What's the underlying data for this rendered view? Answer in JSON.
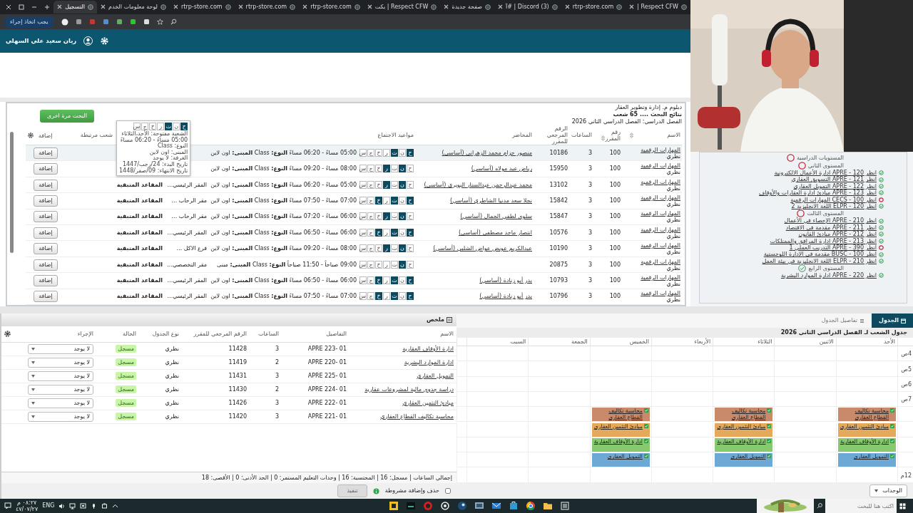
{
  "browser": {
    "tabs": [
      {
        "title": "Respect CFW |",
        "selected": false
      },
      {
        "title": "rtrp-store.com",
        "selected": false
      },
      {
        "title": "(3) Discord | #آ",
        "selected": false
      },
      {
        "title": "صفحة جديدة",
        "selected": false
      },
      {
        "title": "Respect CFW | بكت",
        "selected": false
      },
      {
        "title": "rtrp-store.com",
        "selected": false
      },
      {
        "title": "rtrp-store.com",
        "selected": false
      },
      {
        "title": "rtrp-store.com",
        "selected": false
      },
      {
        "title": "لوحة معلومات الخدم",
        "selected": false
      },
      {
        "title": "التسجيل",
        "selected": true
      }
    ],
    "action_button": "يجب اتخاذ إجراء"
  },
  "header": {
    "user_name": "ريان سعيد علي السهلي"
  },
  "search_results": {
    "program": "دبلوم م. إدارة وتطوير العقار",
    "results": "نتائج البحث .... 65 شعب",
    "term": "الفصل الدراسي: الفصل الدراسي الثاني 2026",
    "search_again": "البحث مرة اخرى",
    "columns": [
      "الاسم",
      "رقم المقرر",
      "الساعات",
      "الرقم المرجعي للمقرر",
      "المحاضر",
      "مواعيد الاجتماع",
      "شعب مرتبطة",
      "إضافة"
    ],
    "rows": [
      {
        "name": "المهارات الرقمية",
        "type": "نظري",
        "course": "100",
        "hours": "3",
        "crn": "10186",
        "instructor": "منصور حزام محمد الزهراني (أساسي)",
        "hovered": true,
        "days": [
          {
            "label": "ح",
            "on": true
          },
          {
            "label": "ن",
            "on": false
          },
          {
            "label": "ث",
            "on": true
          },
          {
            "label": "ر",
            "on": false
          },
          {
            "label": "خ",
            "on": false
          },
          {
            "label": "ج",
            "on": false
          },
          {
            "label": "س",
            "on": false
          }
        ],
        "meeting": "05:00 مساءً - 06:20 مساءً **النوع:** Class **المبنى:** اون لاين",
        "add": "إضافة"
      },
      {
        "name": "المهارات الرقمية",
        "type": "نظري",
        "course": "100",
        "hours": "3",
        "crn": "15950",
        "instructor": "رياض عبد مولاه (أساسي)",
        "hovered": false,
        "days": [
          {
            "label": "ح",
            "on": false
          },
          {
            "label": "ن",
            "on": true
          },
          {
            "label": "ث",
            "on": false
          },
          {
            "label": "ر",
            "on": true
          },
          {
            "label": "خ",
            "on": false
          },
          {
            "label": "ج",
            "on": false
          },
          {
            "label": "س",
            "on": false
          }
        ],
        "meeting": "08:00 مساءً - 09:20 مساءً **النوع:** Class **المبنى:** اون لاين",
        "add": "إضافة"
      },
      {
        "name": "المهارات الرقمية",
        "type": "نظري",
        "course": "100",
        "hours": "3",
        "crn": "13102",
        "instructor": "محمد عبدالرحمن عبدالستار البويري (أساسي)",
        "hovered": false,
        "days": [
          {
            "label": "ح",
            "on": false
          },
          {
            "label": "ن",
            "on": true
          },
          {
            "label": "ث",
            "on": false
          },
          {
            "label": "ر",
            "on": true
          },
          {
            "label": "خ",
            "on": false
          },
          {
            "label": "ج",
            "on": false
          },
          {
            "label": "س",
            "on": false
          }
        ],
        "meeting": "05:00 مساءً - 06:20 مساءً **النوع:** Class **المبنى:** اون لاين",
        "building": "المقر الرئيسي...",
        "hall": "المقاعد المتبقية",
        "add": "إضافة"
      },
      {
        "name": "المهارات الرقمية",
        "type": "نظري",
        "course": "100",
        "hours": "3",
        "crn": "15842",
        "instructor": "نجلا سعد مدنيا الشاطري (أساسي)",
        "hovered": false,
        "days": [
          {
            "label": "ح",
            "on": true
          },
          {
            "label": "ن",
            "on": false
          },
          {
            "label": "ث",
            "on": true
          },
          {
            "label": "ر",
            "on": false
          },
          {
            "label": "خ",
            "on": true
          },
          {
            "label": "ج",
            "on": false
          },
          {
            "label": "س",
            "on": false
          }
        ],
        "meeting": "07:00 مساءً - 07:50 مساءً **النوع:** Class **المبنى:** اون لاين",
        "building": "مقر الرحاب ...",
        "hall": "المقاعد المتبقية",
        "add": "إضافة"
      },
      {
        "name": "المهارات الرقمية",
        "type": "نظري",
        "course": "100",
        "hours": "3",
        "crn": "15847",
        "instructor": "سلوى لطفي الجمال (أساسي)",
        "hovered": false,
        "days": [
          {
            "label": "ح",
            "on": false
          },
          {
            "label": "ن",
            "on": true
          },
          {
            "label": "ث",
            "on": false
          },
          {
            "label": "ر",
            "on": true
          },
          {
            "label": "خ",
            "on": false
          },
          {
            "label": "ج",
            "on": false
          },
          {
            "label": "س",
            "on": false
          }
        ],
        "meeting": "06:00 مساءً - 07:20 مساءً **النوع:** Class **المبنى:** اون لاين",
        "building": "مقر الرحاب ...",
        "hall": "المقاعد المتبقية",
        "add": "إضافة"
      },
      {
        "name": "المهارات الرقمية",
        "type": "نظري",
        "course": "100",
        "hours": "3",
        "crn": "10576",
        "instructor": "انتصار ماجد مصطفى (أساسي)",
        "hovered": false,
        "days": [
          {
            "label": "ح",
            "on": true
          },
          {
            "label": "ن",
            "on": false
          },
          {
            "label": "ث",
            "on": true
          },
          {
            "label": "ر",
            "on": false
          },
          {
            "label": "خ",
            "on": true
          },
          {
            "label": "ج",
            "on": false
          },
          {
            "label": "س",
            "on": false
          }
        ],
        "meeting": "06:00 مساءً - 06:50 مساءً **النوع:** Class **المبنى:** اون لاين",
        "building": "المقر الرئيسي...",
        "hall": "المقاعد المتبقية",
        "add": "إضافة"
      },
      {
        "name": "المهارات الرقمية",
        "type": "نظري",
        "course": "100",
        "hours": "3",
        "crn": "10190",
        "instructor": "عبدالكريم عويض عواض الشلبي (أساسي)",
        "hovered": false,
        "days": [
          {
            "label": "ح",
            "on": false
          },
          {
            "label": "ن",
            "on": true
          },
          {
            "label": "ث",
            "on": false
          },
          {
            "label": "ر",
            "on": true
          },
          {
            "label": "خ",
            "on": false
          },
          {
            "label": "ج",
            "on": false
          },
          {
            "label": "س",
            "on": false
          }
        ],
        "meeting": "08:00 مساءً - 09:20 مساءً **النوع:** Class **المبنى:** اون لاين",
        "building": "فرع الاكل ...",
        "hall": "المقاعد المتبقية",
        "add": "إضافة"
      },
      {
        "name": "المهارات الرقمية",
        "type": "نظري",
        "course": "100",
        "hours": "3",
        "crn": "20875",
        "hovered": false,
        "days": [
          {
            "label": "ح",
            "on": false
          },
          {
            "label": "ن",
            "on": true
          },
          {
            "label": "ث",
            "on": false
          },
          {
            "label": "ر",
            "on": false
          },
          {
            "label": "خ",
            "on": false
          },
          {
            "label": "ج",
            "on": false
          },
          {
            "label": "س",
            "on": false
          }
        ],
        "meeting": "09:00 صباحاً - 11:50 صباحاً **النوع:** Class **المبنى:** مبنى",
        "building": "مقر التخصصي...",
        "hall": "المقاعد المتبقية",
        "add": "إضافة"
      },
      {
        "name": "المهارات الرقمية",
        "type": "نظري",
        "course": "100",
        "hours": "3",
        "crn": "10793",
        "instructor": "بدر أبو زنادة (أساسي)",
        "hovered": false,
        "days": [
          {
            "label": "ح",
            "on": true
          },
          {
            "label": "ن",
            "on": false
          },
          {
            "label": "ث",
            "on": true
          },
          {
            "label": "ر",
            "on": false
          },
          {
            "label": "خ",
            "on": true
          },
          {
            "label": "ج",
            "on": false
          },
          {
            "label": "س",
            "on": false
          }
        ],
        "meeting": "06:00 مساءً - 06:50 مساءً **النوع:** Class **المبنى:** اون لاين",
        "building": "المقر الرئيسي...",
        "hall": "المقاعد المتبقية",
        "add": "إضافة"
      },
      {
        "name": "المهارات الرقمية",
        "type": "نظري",
        "course": "100",
        "hours": "3",
        "crn": "10796",
        "instructor": "بدر أبو زنادة (أساسي)",
        "hovered": false,
        "days": [
          {
            "label": "ح",
            "on": true
          },
          {
            "label": "ن",
            "on": false
          },
          {
            "label": "ث",
            "on": true
          },
          {
            "label": "ر",
            "on": false
          },
          {
            "label": "خ",
            "on": true
          },
          {
            "label": "ج",
            "on": false
          },
          {
            "label": "س",
            "on": false
          }
        ],
        "meeting": "07:00 مساءً - 07:50 مساءً **النوع:** Class **المبنى:** اون لاين",
        "building": "المقر الرئيسي...",
        "hall": "المقاعد المتبقية",
        "add": "إضافة"
      }
    ],
    "tooltip": {
      "days": [
        {
          "label": "ح",
          "on": true
        },
        {
          "label": "ن",
          "on": false
        },
        {
          "label": "ث",
          "on": true
        },
        {
          "label": "ر",
          "on": false
        },
        {
          "label": "خ",
          "on": false
        },
        {
          "label": "ج",
          "on": false
        },
        {
          "label": "س",
          "on": false
        }
      ],
      "lines": [
        "الشعبة مفتوحة: الأحد،الثلاثاء",
        "05:00 مساءً - 06:20 مساءً",
        "النوع: Class",
        "المبنى: اون لاين",
        "الغرفة: لا يوجد",
        "تاريخ البدء: 24/رجب/1447",
        "تاريخ الانتهاء: 09/صفر/1448"
      ]
    }
  },
  "levels": [
    {
      "title": "المستويات الدراسية",
      "done": false
    },
    {
      "title": "المستوى الثاني",
      "done": false,
      "courses": [
        {
          "text": "انظر APRE - 120 ادارة الأعمال الالكترونية",
          "done": true
        },
        {
          "text": "انظر APRE - 121 التسويق العقاري",
          "done": true
        },
        {
          "text": "انظر APRE - 122 التمويل العقاري",
          "done": true
        },
        {
          "text": "انظر APRE - 123 مبادئ ادارة العقارات والأوقاف",
          "done": true
        },
        {
          "text": "انظر CECS - 100 المهارات الرقمية",
          "done": false
        },
        {
          "text": "انظر ELPR - 120 اللغة الانجليزية 2",
          "done": true
        }
      ]
    },
    {
      "title": "المستوى الثالث",
      "done": false,
      "courses": [
        {
          "text": "انظر APRE - 210 الإحصاء في الأعمال",
          "done": true
        },
        {
          "text": "انظر APRE - 211 مقدمة في الاقتصاد",
          "done": true
        },
        {
          "text": "انظر APRE - 212 مبادئ القانون",
          "done": true
        },
        {
          "text": "انظر APRE - 213 ادارة المرافق والممتلكات",
          "done": true
        },
        {
          "text": "انظر APRE - 390 التدريب العملي 1",
          "done": false
        },
        {
          "text": "انظر BUSC - 100 مقدمة في الإدارة اللوجستية",
          "done": true
        },
        {
          "text": "انظر ELPR - 210 اللغة الانجليزية في بيئة العمل",
          "done": true
        }
      ]
    },
    {
      "title": "المستوى الرابع",
      "done": true,
      "courses": [
        {
          "text": "انظر APRE - 220 ادارة الموارد البشرية",
          "done": true
        }
      ]
    }
  ],
  "summary": {
    "title": "ملخص",
    "columns": [
      "الاسم",
      "التفاصيل",
      "الساعات",
      "الرقم المرجعي للمقرر",
      "نوع الجدول",
      "الحالة",
      "الإجراء"
    ],
    "rows": [
      {
        "name": "ادارة الأوقاف العقارية",
        "details": "APRE 223- 01",
        "hours": "3",
        "crn": "11428",
        "schedule": "نظري",
        "status": "مسجل",
        "action": "لا يوجد"
      },
      {
        "name": "ادارة الموارد البشرية",
        "details": "APRE 220- 01",
        "hours": "2",
        "crn": "11419",
        "schedule": "نظري",
        "status": "مسجل",
        "action": "لا يوجد"
      },
      {
        "name": "التمويل العقاري",
        "details": "APRE 225- 01",
        "hours": "3",
        "crn": "11431",
        "schedule": "نظري",
        "status": "مسجل",
        "action": "لا يوجد"
      },
      {
        "name": "دراسة جدوى مالية لمشروعات عقارية",
        "details": "APRE 224- 01",
        "hours": "2",
        "crn": "11430",
        "schedule": "نظري",
        "status": "مسجل",
        "action": "لا يوجد"
      },
      {
        "name": "مبادئ التثمين العقاري",
        "details": "APRE 222- 01",
        "hours": "3",
        "crn": "11426",
        "schedule": "نظري",
        "status": "مسجل",
        "action": "لا يوجد"
      },
      {
        "name": "محاسبة تكاليف القطاع العقاري",
        "details": "APRE 221- 01",
        "hours": "3",
        "crn": "11420",
        "schedule": "نظري",
        "status": "مسجل",
        "action": "لا يوجد"
      }
    ],
    "totals": "إجمالي الساعات | مسجل: 16 | المحتسبة: 16 | وحدات التعليم المستمر: 0 | الحد الأدنى: 0 | الأقصى: 18",
    "submit": {
      "label": "تنفيذ",
      "disabled": true
    },
    "conditional": {
      "label": "حذف وإضافة مشروطة",
      "checked": false
    }
  },
  "calendar": {
    "tabs": [
      {
        "label": "الجدول",
        "selected": true
      },
      {
        "label": "تفاصيل الجدول",
        "selected": false
      }
    ],
    "title": "جدول الشعب لـ الفصل الدراسي الثاني 2026",
    "time_labels": [
      "4ص",
      "5ص",
      "6ص",
      "7ص"
    ],
    "bottom_label": "12م",
    "days": [
      {
        "label": "الأحد",
        "events": [
          {
            "title": "محاسبة تكاليف القطاع العقاري",
            "color": "#c98a6c"
          },
          {
            "title": "مبادئ التثمين العقاري",
            "color": "#e5a95c"
          },
          {
            "title": "ادارة الأوقاف العقارية",
            "color": "#86c96f"
          },
          {
            "title": "التمويل العقاري",
            "color": "#6ea9d6"
          }
        ]
      },
      {
        "label": "الاثنين"
      },
      {
        "label": "الثلاثاء",
        "events": [
          {
            "title": "محاسبة تكاليف القطاع العقاري",
            "color": "#c98a6c"
          },
          {
            "title": "مبادئ التثمين العقاري",
            "color": "#e5a95c"
          },
          {
            "title": "ادارة الأوقاف العقارية",
            "color": "#86c96f"
          },
          {
            "title": "التمويل العقاري",
            "color": "#6ea9d6"
          }
        ]
      },
      {
        "label": "الأربعاء"
      },
      {
        "label": "الخميس",
        "events": [
          {
            "title": "محاسبة تكاليف القطاع العقاري",
            "color": "#c98a6c"
          },
          {
            "title": "مبادئ التثمين العقاري",
            "color": "#e5a95c"
          },
          {
            "title": "ادارة الأوقاف العقارية",
            "color": "#86c96f"
          },
          {
            "title": "التمويل العقاري",
            "color": "#6ea9d6"
          }
        ]
      },
      {
        "label": "الجمعة"
      },
      {
        "label": "السبت"
      }
    ],
    "units": "الوحدات"
  },
  "taskbar": {
    "language": "ENG",
    "time": "٠٨:٢٧ م",
    "date": "٤٧/٠٧/٢٧",
    "search_placeholder": "اكتب هنا للبحث"
  }
}
